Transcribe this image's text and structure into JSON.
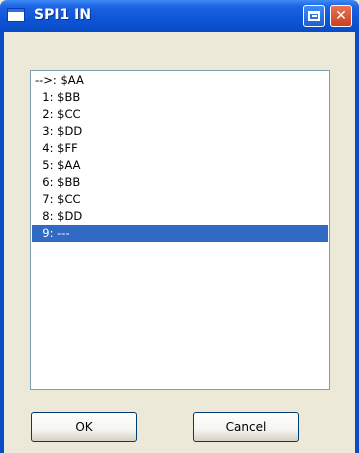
{
  "window": {
    "title": "SPI1 IN"
  },
  "list": {
    "items": [
      {
        "label": "-->: $AA",
        "selected": false
      },
      {
        "label": "  1: $BB",
        "selected": false
      },
      {
        "label": "  2: $CC",
        "selected": false
      },
      {
        "label": "  3: $DD",
        "selected": false
      },
      {
        "label": "  4: $FF",
        "selected": false
      },
      {
        "label": "  5: $AA",
        "selected": false
      },
      {
        "label": "  6: $BB",
        "selected": false
      },
      {
        "label": "  7: $CC",
        "selected": false
      },
      {
        "label": "  8: $DD",
        "selected": false
      },
      {
        "label": "  9: ---",
        "selected": true
      }
    ]
  },
  "buttons": {
    "ok_label": "OK",
    "cancel_label": "Cancel"
  },
  "colors": {
    "selection": "#316ac5",
    "titlebar": "#0d55d8"
  },
  "icons": {
    "title": "window-icon",
    "restore": "restore-icon",
    "close": "close-icon"
  }
}
